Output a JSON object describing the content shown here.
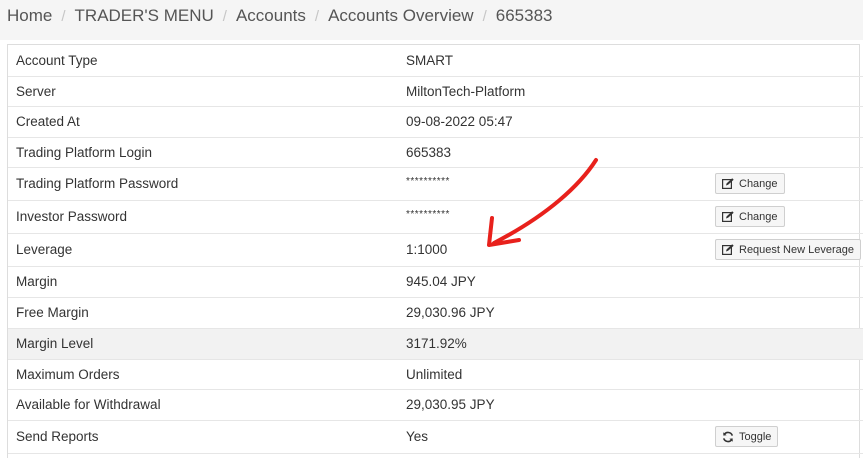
{
  "breadcrumb": {
    "items": [
      "Home",
      "TRADER'S MENU",
      "Accounts",
      "Accounts Overview"
    ],
    "current": "665383",
    "separator": "/"
  },
  "account": {
    "account_type_label": "Account Type",
    "account_type": "SMART",
    "server_label": "Server",
    "server": "MiltonTech-Platform",
    "created_at_label": "Created At",
    "created_at": "09-08-2022 05:47",
    "login_label": "Trading Platform Login",
    "login": "665383",
    "platform_password_label": "Trading Platform Password",
    "platform_password": "**********",
    "investor_password_label": "Investor Password",
    "investor_password": "**********",
    "leverage_label": "Leverage",
    "leverage": "1:1000",
    "margin_label": "Margin",
    "margin": "945.04 JPY",
    "free_margin_label": "Free Margin",
    "free_margin": "29,030.96 JPY",
    "margin_level_label": "Margin Level",
    "margin_level": "3171.92%",
    "max_orders_label": "Maximum Orders",
    "max_orders": "Unlimited",
    "withdrawal_label": "Available for Withdrawal",
    "withdrawal": "29,030.95 JPY",
    "send_reports_label": "Send Reports",
    "send_reports": "Yes"
  },
  "buttons": {
    "change_platform_password": "Change",
    "change_investor_password": "Change",
    "request_leverage": "Request New Leverage",
    "toggle_reports": "Toggle"
  },
  "colors": {
    "yes_green": "#5cb85c",
    "annotation_red": "#e8211c",
    "shaded_row": "#f2f2f2"
  },
  "icons": {
    "edit": "pencil-square-icon",
    "toggle": "refresh-icon"
  }
}
